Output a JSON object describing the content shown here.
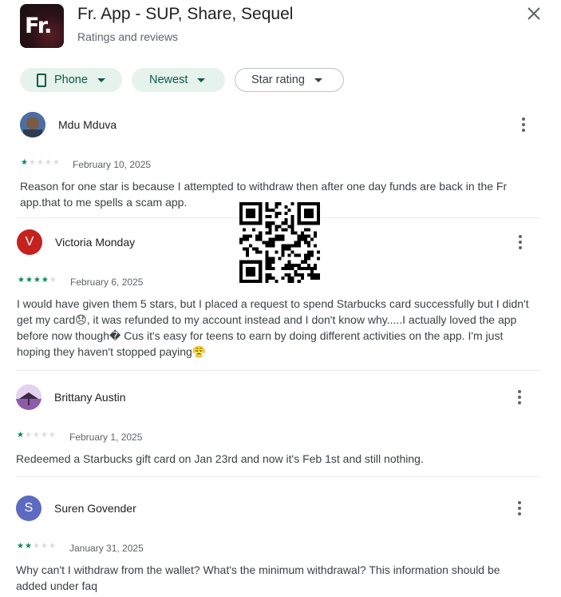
{
  "header": {
    "app_icon_text": "Fr.",
    "title": "Fr. App - SUP, Share, Sequel",
    "subtitle": "Ratings and reviews",
    "close_icon": "close-icon"
  },
  "filters": {
    "device": "Phone",
    "sort": "Newest",
    "rating": "Star rating"
  },
  "colors": {
    "accent": "#01875f",
    "chip_bg": "#e6f2ec",
    "avatar_victoria": "#c5221f",
    "avatar_suren": "#5c6bc0"
  },
  "reviews": [
    {
      "name": "Mdu Mduva",
      "avatar_letter": "",
      "stars": 1,
      "date": "February 10, 2025",
      "text": "Reason for one star is because I attempted to withdraw then after one day funds are back in the Fr app.that to me spells a scam app."
    },
    {
      "name": "Victoria Monday",
      "avatar_letter": "V",
      "stars": 4,
      "date": "February 6, 2025",
      "text": "I would have given them 5 stars, but I placed a request to spend Starbucks card successfully but I didn't get my card😞, it was refunded to my account instead and I don't know why.....I actually loved the app before now though� Cus it's easy for teens to earn by doing different activities on the app. I'm just hoping they haven't stopped paying😤"
    },
    {
      "name": "Brittany Austin",
      "avatar_letter": "",
      "stars": 1,
      "date": "February 1, 2025",
      "text": "Redeemed a Starbucks gift card on Jan 23rd and now it's Feb 1st and still nothing."
    },
    {
      "name": "Suren Govender",
      "avatar_letter": "S",
      "stars": 2,
      "date": "January 31, 2025",
      "text": "Why can't I withdraw from the wallet? What's the minimum withdrawal? This information should be added under faq"
    }
  ]
}
